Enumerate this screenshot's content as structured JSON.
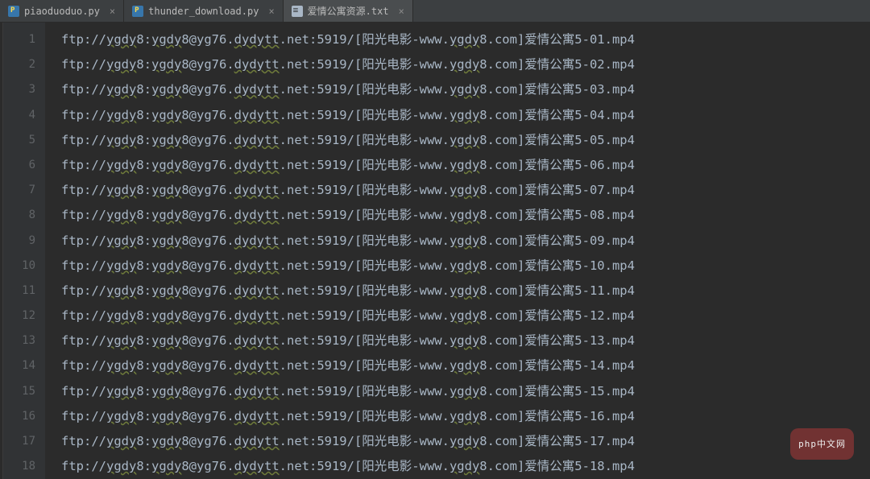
{
  "tabs": [
    {
      "label": "piaoduoduo.py",
      "icon": "py",
      "active": false,
      "closable": true
    },
    {
      "label": "thunder_download.py",
      "icon": "py",
      "active": false,
      "closable": true
    },
    {
      "label": "爱情公寓资源.txt",
      "icon": "txt",
      "active": true,
      "closable": true
    }
  ],
  "editor": {
    "line_count": 18,
    "url_prefix": "ftp://ygdy8:ygdy8@yg76.dydytt.net:5919/[阳光电影-www.ygdy8.com]爱情公寓5-",
    "url_suffix": ".mp4",
    "lines": [
      "ftp://ygdy8:ygdy8@yg76.dydytt.net:5919/[阳光电影-www.ygdy8.com]爱情公寓5-01.mp4",
      "ftp://ygdy8:ygdy8@yg76.dydytt.net:5919/[阳光电影-www.ygdy8.com]爱情公寓5-02.mp4",
      "ftp://ygdy8:ygdy8@yg76.dydytt.net:5919/[阳光电影-www.ygdy8.com]爱情公寓5-03.mp4",
      "ftp://ygdy8:ygdy8@yg76.dydytt.net:5919/[阳光电影-www.ygdy8.com]爱情公寓5-04.mp4",
      "ftp://ygdy8:ygdy8@yg76.dydytt.net:5919/[阳光电影-www.ygdy8.com]爱情公寓5-05.mp4",
      "ftp://ygdy8:ygdy8@yg76.dydytt.net:5919/[阳光电影-www.ygdy8.com]爱情公寓5-06.mp4",
      "ftp://ygdy8:ygdy8@yg76.dydytt.net:5919/[阳光电影-www.ygdy8.com]爱情公寓5-07.mp4",
      "ftp://ygdy8:ygdy8@yg76.dydytt.net:5919/[阳光电影-www.ygdy8.com]爱情公寓5-08.mp4",
      "ftp://ygdy8:ygdy8@yg76.dydytt.net:5919/[阳光电影-www.ygdy8.com]爱情公寓5-09.mp4",
      "ftp://ygdy8:ygdy8@yg76.dydytt.net:5919/[阳光电影-www.ygdy8.com]爱情公寓5-10.mp4",
      "ftp://ygdy8:ygdy8@yg76.dydytt.net:5919/[阳光电影-www.ygdy8.com]爱情公寓5-11.mp4",
      "ftp://ygdy8:ygdy8@yg76.dydytt.net:5919/[阳光电影-www.ygdy8.com]爱情公寓5-12.mp4",
      "ftp://ygdy8:ygdy8@yg76.dydytt.net:5919/[阳光电影-www.ygdy8.com]爱情公寓5-13.mp4",
      "ftp://ygdy8:ygdy8@yg76.dydytt.net:5919/[阳光电影-www.ygdy8.com]爱情公寓5-14.mp4",
      "ftp://ygdy8:ygdy8@yg76.dydytt.net:5919/[阳光电影-www.ygdy8.com]爱情公寓5-15.mp4",
      "ftp://ygdy8:ygdy8@yg76.dydytt.net:5919/[阳光电影-www.ygdy8.com]爱情公寓5-16.mp4",
      "ftp://ygdy8:ygdy8@yg76.dydytt.net:5919/[阳光电影-www.ygdy8.com]爱情公寓5-17.mp4",
      "ftp://ygdy8:ygdy8@yg76.dydytt.net:5919/[阳光电影-www.ygdy8.com]爱情公寓5-18.mp4"
    ],
    "wavy_segments": [
      "ygdy",
      "ygdy",
      "dydytt",
      "ygdy"
    ]
  },
  "badge": {
    "text": "php中文网"
  },
  "colors": {
    "bg": "#2b2b2b",
    "panel": "#3c3f41",
    "gutter": "#313335",
    "gutter_text": "#606366",
    "text": "#a9b7c6"
  }
}
